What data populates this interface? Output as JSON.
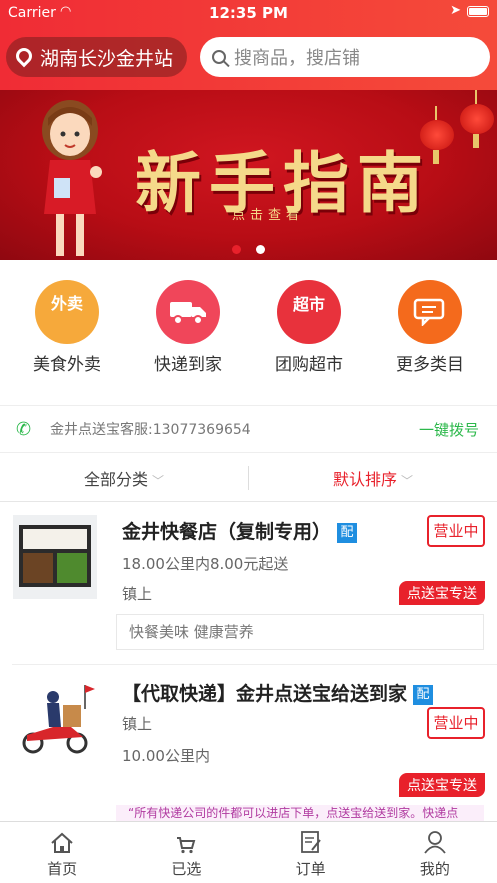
{
  "status": {
    "carrier": "Carrier",
    "time": "12:35 PM"
  },
  "header": {
    "city": "湖南长沙金井站",
    "search_placeholder": "搜商品，搜店铺"
  },
  "banner": {
    "title": "新手指南",
    "subtitle": "点击查看",
    "active_dot": 0
  },
  "categories": [
    {
      "label": "美食外卖",
      "badge": "外卖",
      "color": "#f6a93b"
    },
    {
      "label": "快递到家",
      "badge": "",
      "color": "#f0465a"
    },
    {
      "label": "团购超市",
      "badge": "超市",
      "color": "#e8323c"
    },
    {
      "label": "更多类目",
      "badge": "",
      "color": "#f46a1c"
    }
  ],
  "hotline": {
    "text": "金井点送宝客服:13077369654",
    "dial": "一键拨号"
  },
  "sort": {
    "category": "全部分类",
    "order": "默认排序"
  },
  "shops": [
    {
      "name": "金井快餐店（复制专用）",
      "pei": "配",
      "status": "营业中",
      "line1": "18.00公里内8.00元起送",
      "line2": "镇上",
      "tag": "点送宝专送",
      "note": "快餐美味 健康营养"
    },
    {
      "name": "【代取快递】金井点送宝给送到家",
      "pei": "配",
      "status": "营业中",
      "line1": "镇上",
      "line2": "10.00公里内",
      "tag": "点送宝专送",
      "note": "“所有快递公司的件都可以进店下单，点送宝给送到家。快递点"
    }
  ],
  "tabs": [
    {
      "label": "首页"
    },
    {
      "label": "已选"
    },
    {
      "label": "订单"
    },
    {
      "label": "我的"
    }
  ],
  "colors": {
    "primary": "#e8212b",
    "green": "#2cb84b",
    "blue_badge": "#1f8ee0"
  }
}
